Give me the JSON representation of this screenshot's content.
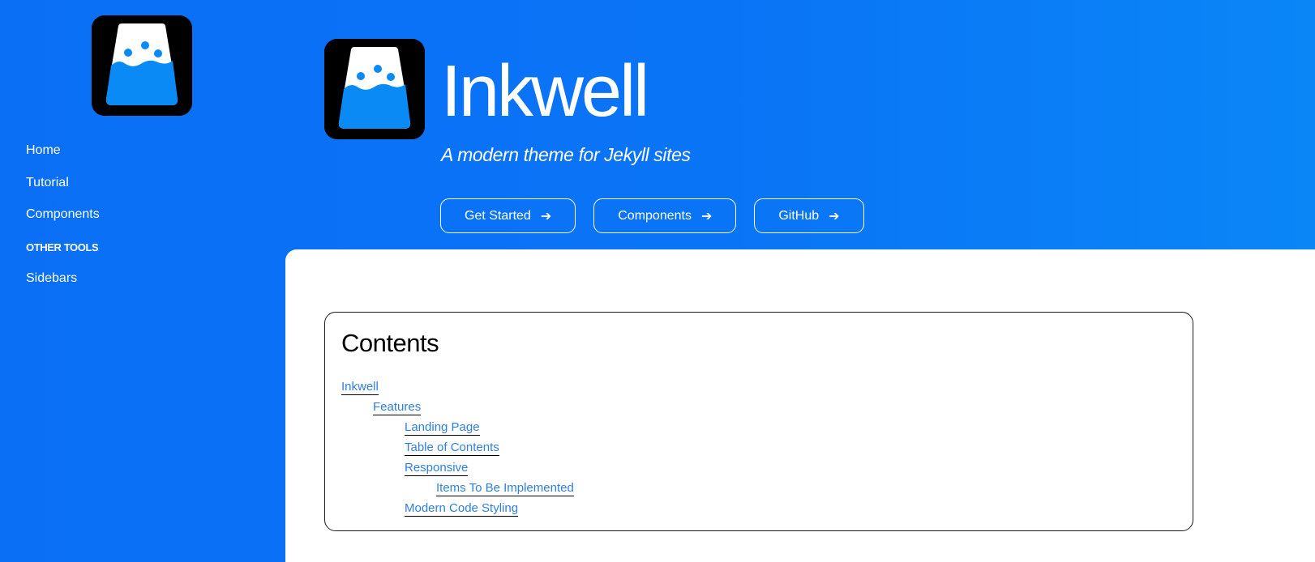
{
  "colors": {
    "background": "#0a74f6",
    "logo_water": "#0a8af5",
    "logo_bg": "#000000",
    "link": "#2f7fe0"
  },
  "logo": {
    "icon": "inkwell-logo-icon"
  },
  "sidebar": {
    "items": [
      {
        "label": "Home"
      },
      {
        "label": "Tutorial"
      },
      {
        "label": "Components"
      }
    ],
    "section_label": "OTHER TOOLS",
    "section_items": [
      {
        "label": "Sidebars"
      }
    ]
  },
  "hero": {
    "title": "Inkwell",
    "tagline": "A modern theme for Jekyll sites",
    "buttons": [
      {
        "label": "Get Started",
        "icon": "arrow-right-icon"
      },
      {
        "label": "Components",
        "icon": "arrow-right-icon"
      },
      {
        "label": "GitHub",
        "icon": "arrow-right-icon"
      }
    ]
  },
  "toc": {
    "heading": "Contents",
    "items": [
      {
        "label": "Inkwell",
        "level": 1
      },
      {
        "label": "Features",
        "level": 2
      },
      {
        "label": "Landing Page",
        "level": 3
      },
      {
        "label": "Table of Contents",
        "level": 3
      },
      {
        "label": "Responsive",
        "level": 3
      },
      {
        "label": "Items To Be Implemented",
        "level": 4
      },
      {
        "label": "Modern Code Styling",
        "level": 3
      }
    ]
  }
}
